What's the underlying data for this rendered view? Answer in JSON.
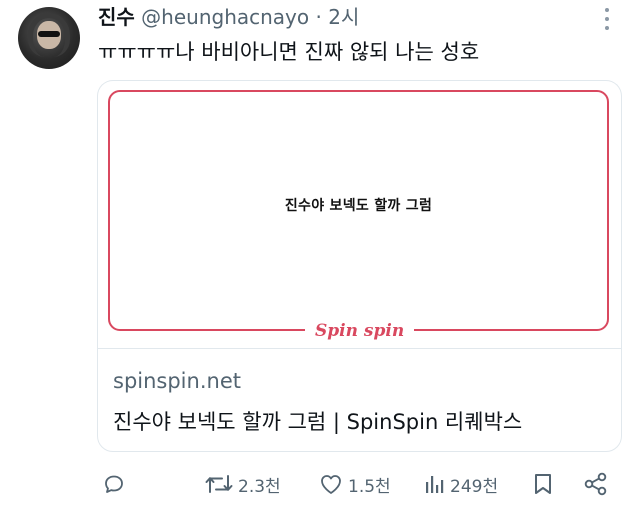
{
  "tweet": {
    "author_name": "진수",
    "handle": "@heunghacnayo",
    "separator": " · ",
    "time": "2시",
    "text": "ㅠㅠㅠㅠ나 바비아니면 진짜 않되 나는 성호"
  },
  "card": {
    "image_text": "진수야 보넥도 할까 그럼",
    "logo_text": "Spin spin",
    "domain": "spinspin.net",
    "title": "진수야 보넥도 할까 그럼 | SpinSpin 리퀘박스"
  },
  "actions": {
    "reply_count": "",
    "retweet_count": "2.3천",
    "like_count": "1.5천",
    "view_count": "249천"
  },
  "icons": {
    "reply": "reply-icon",
    "retweet": "retweet-icon",
    "like": "heart-icon",
    "views": "analytics-icon",
    "bookmark": "bookmark-icon",
    "share": "share-icon",
    "more": "more-dots-icon"
  },
  "colors": {
    "card_accent": "#d9485f",
    "muted_text": "#536471",
    "icon": "#536471"
  }
}
